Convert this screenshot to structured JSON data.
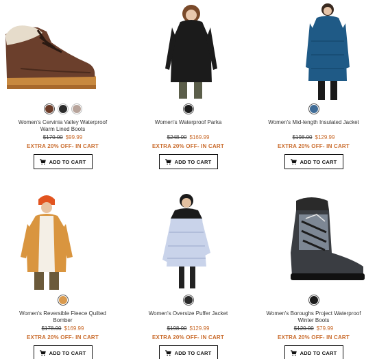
{
  "products": [
    {
      "name_line1": "Women's Cervinia Valley Waterproof",
      "name_line2": "Warm Lined Boots",
      "old_price": "$170.00",
      "new_price": "$99.99",
      "promo": "EXTRA 20% OFF- IN CART",
      "button": "ADD TO CART",
      "swatches": [
        "#6b3b28",
        "#2b2b2b",
        "#b7a39a"
      ],
      "image_icon": "boot-icon"
    },
    {
      "name_line1": "Women's Waterproof Parka",
      "name_line2": "",
      "old_price": "$248.00",
      "new_price": "$169.99",
      "promo": "EXTRA 20% OFF- IN CART",
      "button": "ADD TO CART",
      "swatches": [
        "#1c1c1c"
      ],
      "image_icon": "parka-icon"
    },
    {
      "name_line1": "Women's Mid-length Insulated Jacket",
      "name_line2": "",
      "old_price": "$198.00",
      "new_price": "$129.99",
      "promo": "EXTRA 20% OFF- IN CART",
      "button": "ADD TO CART",
      "swatches": [
        "#3f6c97"
      ],
      "image_icon": "jacket-icon"
    },
    {
      "name_line1": "Women's Reversible Fleece Quilted",
      "name_line2": "Bomber",
      "old_price": "$178.00",
      "new_price": "$169.99",
      "promo": "EXTRA 20% OFF- IN CART",
      "button": "ADD TO CART",
      "swatches": [
        "#d99a4e"
      ],
      "image_icon": "bomber-icon"
    },
    {
      "name_line1": "Women's Oversize Puffer Jacket",
      "name_line2": "",
      "old_price": "$198.00",
      "new_price": "$129.99",
      "promo": "EXTRA 20% OFF- IN CART",
      "button": "ADD TO CART",
      "swatches": [
        "#2b2b2b"
      ],
      "image_icon": "puffer-icon"
    },
    {
      "name_line1": "Women's Boroughs Project Waterproof",
      "name_line2": "Winter Boots",
      "old_price": "$120.00",
      "new_price": "$79.99",
      "promo": "EXTRA 20% OFF- IN CART",
      "button": "ADD TO CART",
      "swatches": [
        "#1c1c1c"
      ],
      "image_icon": "snow-boot-icon"
    }
  ],
  "colors": {
    "accent": "#c96a2a",
    "button_border": "#111111"
  }
}
